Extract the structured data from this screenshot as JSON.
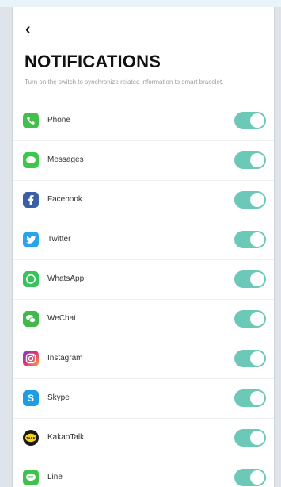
{
  "header": {
    "back_icon": "chevron-left-icon",
    "title": "NOTIFICATIONS",
    "subtitle": "Turn on the switch to synchronize related information to smart bracelet."
  },
  "apps": [
    {
      "name": "Phone",
      "icon": "phone-icon",
      "color": "#43c04b",
      "enabled": true
    },
    {
      "name": "Messages",
      "icon": "message-bubble-icon",
      "color": "#3cc84a",
      "enabled": true
    },
    {
      "name": "Facebook",
      "icon": "facebook-icon",
      "color": "#3b5ea8",
      "enabled": true
    },
    {
      "name": "Twitter",
      "icon": "twitter-icon",
      "color": "#2aa3e8",
      "enabled": true
    },
    {
      "name": "WhatsApp",
      "icon": "whatsapp-icon",
      "color": "#35c35a",
      "enabled": true
    },
    {
      "name": "WeChat",
      "icon": "wechat-icon",
      "color": "#3fba4a",
      "enabled": true
    },
    {
      "name": "Instagram",
      "icon": "instagram-icon",
      "color": "#e0357a",
      "enabled": true
    },
    {
      "name": "Skype",
      "icon": "skype-icon",
      "color": "#1e9ee2",
      "enabled": true
    },
    {
      "name": "KakaoTalk",
      "icon": "kakaotalk-icon",
      "color": "#1a1a1a",
      "enabled": true
    },
    {
      "name": "Line",
      "icon": "line-icon",
      "color": "#3ec24b",
      "enabled": true
    }
  ],
  "toggle_color": "#6cc9b8"
}
